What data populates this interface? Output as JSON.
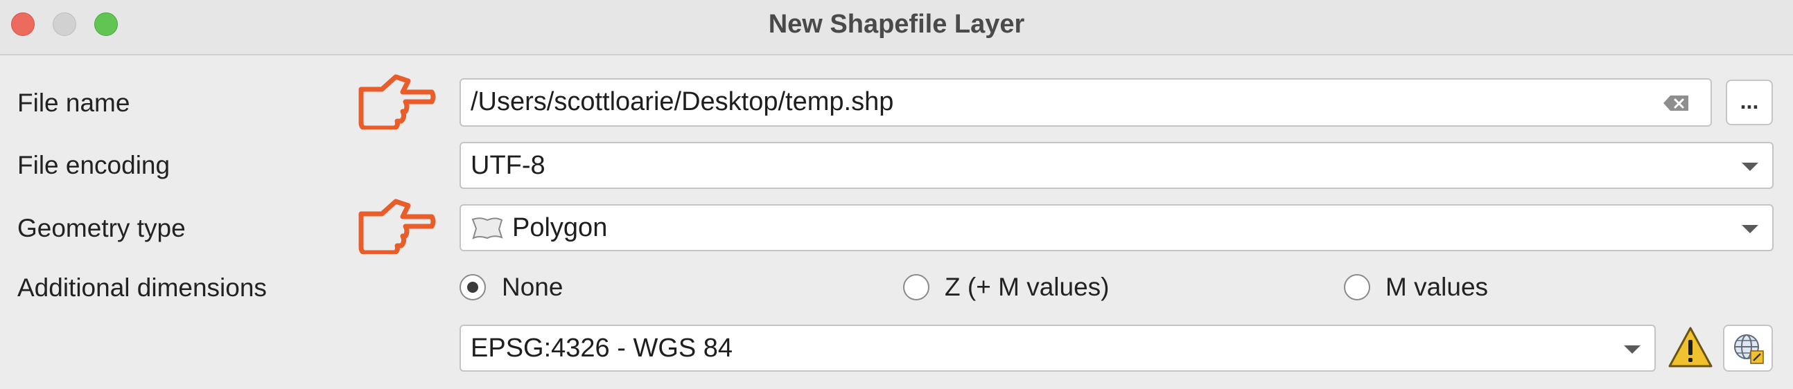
{
  "window": {
    "title": "New Shapefile Layer"
  },
  "file_name": {
    "label": "File name",
    "value": "/Users/scottloarie/Desktop/temp.shp",
    "browse_label": "..."
  },
  "file_encoding": {
    "label": "File encoding",
    "value": "UTF-8"
  },
  "geometry_type": {
    "label": "Geometry type",
    "value": "Polygon"
  },
  "additional_dimensions": {
    "label": "Additional dimensions",
    "options": [
      "None",
      "Z (+ M values)",
      "M values"
    ],
    "selected": "None"
  },
  "crs": {
    "value": "EPSG:4326 - WGS 84"
  },
  "colors": {
    "pointer_arrow": "#e85d2a",
    "warning": "#f2c12e"
  }
}
